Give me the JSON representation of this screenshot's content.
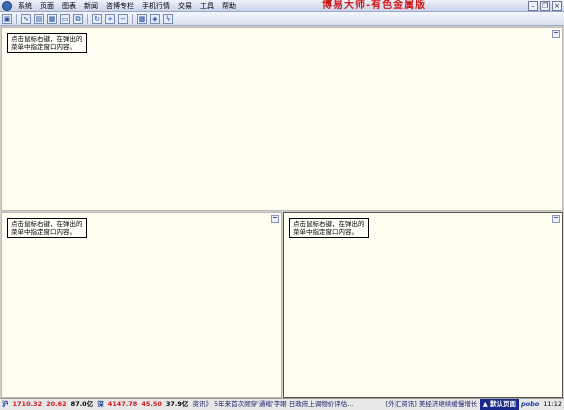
{
  "menu": [
    "系统",
    "页面",
    "图表",
    "新闻",
    "咨博专栏",
    "手机行情",
    "交易",
    "工具",
    "帮助"
  ],
  "app_title": "博易大师-有色金属版",
  "window_buttons": {
    "minimize": "–",
    "restore": "❐",
    "close": "×"
  },
  "toolbar": {
    "tools": [
      {
        "icon": "monitor-icon",
        "glyph": "▣"
      },
      {
        "icon": "line-chart-icon",
        "glyph": "∿"
      },
      {
        "icon": "quote-table-icon",
        "glyph": "▤"
      },
      {
        "icon": "grid-icon",
        "glyph": "▦"
      },
      {
        "icon": "window-icon",
        "glyph": "▭"
      },
      {
        "icon": "multi-window-icon",
        "glyph": "⧉"
      },
      {
        "icon": "refresh-icon",
        "glyph": "↻"
      },
      {
        "icon": "zoom-in-icon",
        "glyph": "+"
      },
      {
        "icon": "zoom-out-icon",
        "glyph": "−"
      },
      {
        "icon": "calculator-icon",
        "glyph": "▩"
      },
      {
        "icon": "palette-icon",
        "glyph": "◈"
      },
      {
        "icon": "lightning-icon",
        "glyph": "ϟ"
      }
    ]
  },
  "panels": {
    "hint": "点击鼠标右键，在弹出的\n菜单中指定窗口内容。"
  },
  "status": {
    "index_icon": "沪",
    "index_value": "1710.32",
    "index_change": "20.62",
    "index_volume": "87.0亿",
    "shen_icon": "深",
    "shen_value": "4147.78",
    "shen_change": "45.50",
    "shen_volume": "37.9亿",
    "news": "资讯》 5年来首次频穿'通缩'字眼 日政府上调物价评估...",
    "fx_news": "[外汇资讯] 美经济继续缓慢增长",
    "default_page": "▲ 默认页面",
    "brand": "pobo",
    "time": "11:12"
  },
  "colors": {
    "accent_red": "#d01818",
    "panel_bg": "#fffef0",
    "status_blue": "#1a2a8a"
  }
}
